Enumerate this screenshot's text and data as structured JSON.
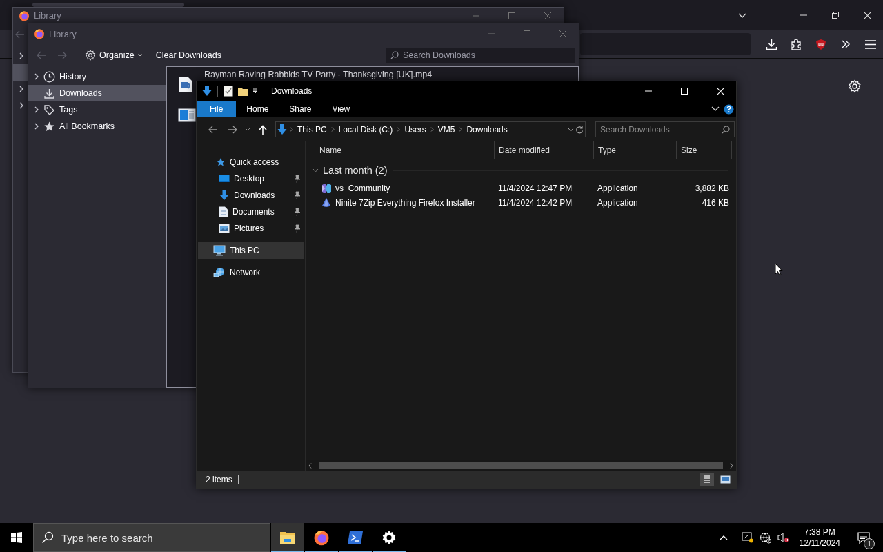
{
  "library_back": {
    "title": "Library",
    "sidebar": [
      {
        "expandable": true,
        "selected": false
      },
      {
        "expandable": false,
        "selected": true
      },
      {
        "expandable": true,
        "selected": false
      },
      {
        "expandable": true,
        "selected": false
      }
    ]
  },
  "library": {
    "title": "Library",
    "organize": "Organize",
    "clear_button": "Clear Downloads",
    "search": {
      "placeholder": "Search Downloads"
    },
    "sidebar": [
      {
        "label": "History",
        "expandable": true,
        "selected": false
      },
      {
        "label": "Downloads",
        "expandable": false,
        "selected": true
      },
      {
        "label": "Tags",
        "expandable": true,
        "selected": false
      },
      {
        "label": "All Bookmarks",
        "expandable": true,
        "selected": false
      }
    ],
    "downloads": [
      {
        "name": "Rayman Raving Rabbids TV Party - Thanksgiving [UK].mp4"
      }
    ]
  },
  "explorer": {
    "title": "Downloads",
    "ribbon_tabs": [
      {
        "label": "File",
        "selected": true
      },
      {
        "label": "Home",
        "selected": false
      },
      {
        "label": "Share",
        "selected": false
      },
      {
        "label": "View",
        "selected": false
      }
    ],
    "breadcrumb": [
      "This PC",
      "Local Disk (C:)",
      "Users",
      "VM5",
      "Downloads"
    ],
    "search": {
      "placeholder": "Search Downloads"
    },
    "nav": [
      {
        "label": "Quick access",
        "selected": false,
        "children": [
          {
            "label": "Desktop",
            "pinned": true,
            "selected": false
          },
          {
            "label": "Downloads",
            "pinned": true,
            "selected": false
          },
          {
            "label": "Documents",
            "pinned": true,
            "selected": false
          },
          {
            "label": "Pictures",
            "pinned": true,
            "selected": false
          }
        ]
      },
      {
        "label": "This PC",
        "selected": true
      },
      {
        "label": "Network",
        "selected": false
      }
    ],
    "columns": [
      "Name",
      "Date modified",
      "Type",
      "Size"
    ],
    "group": {
      "label": "Last month (2)",
      "expanded": true
    },
    "files": [
      {
        "name": "vs_Community",
        "date": "11/4/2024 12:47 PM",
        "type": "Application",
        "size": "3,882 KB",
        "selected": true
      },
      {
        "name": "Ninite 7Zip Everything Firefox Installer",
        "date": "11/4/2024 12:42 PM",
        "type": "Application",
        "size": "416 KB",
        "selected": false
      }
    ],
    "status": "2 items"
  },
  "taskbar": {
    "search": {
      "placeholder": "Type here to search"
    },
    "apps": [
      {
        "active": true
      },
      {
        "active": false
      },
      {
        "active": false
      },
      {
        "active": false
      }
    ],
    "time": "7:38 PM",
    "date": "12/11/2024",
    "notifications": "1"
  }
}
